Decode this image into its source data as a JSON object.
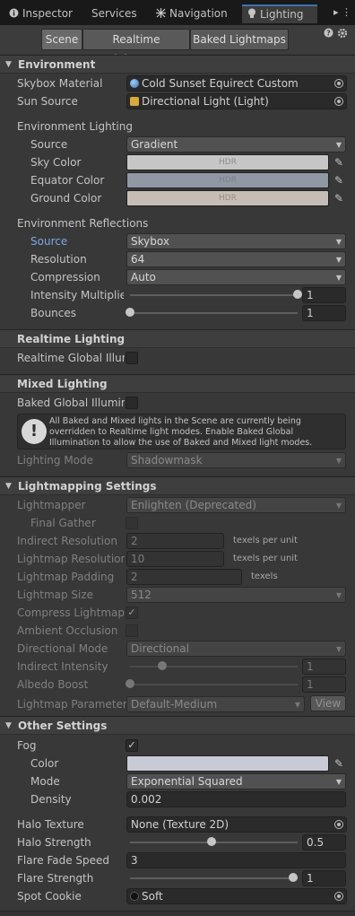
{
  "tabs": {
    "inspector": "Inspector",
    "services": "Services",
    "navigation": "Navigation",
    "lighting": "Lighting"
  },
  "subtabs": {
    "scene": "Scene",
    "realtime": "Realtime Lightmaps",
    "baked": "Baked Lightmaps"
  },
  "environment": {
    "header": "Environment",
    "skybox_label": "Skybox Material",
    "skybox_value": "Cold Sunset Equirect Custom",
    "sun_label": "Sun Source",
    "sun_value": "Directional Light (Light)",
    "lighting_heading": "Environment Lighting",
    "source_label": "Source",
    "source_value": "Gradient",
    "sky_label": "Sky Color",
    "equator_label": "Equator Color",
    "ground_label": "Ground Color",
    "hdr": "HDR",
    "reflections_heading": "Environment Reflections",
    "ref_source_label": "Source",
    "ref_source_value": "Skybox",
    "resolution_label": "Resolution",
    "resolution_value": "64",
    "compression_label": "Compression",
    "compression_value": "Auto",
    "intensity_label": "Intensity Multiplier",
    "intensity_value": "1",
    "intensity_level": 1.0,
    "bounces_label": "Bounces",
    "bounces_value": "1",
    "bounces_level": 0.0
  },
  "realtime": {
    "header": "Realtime Lighting",
    "gi_label": "Realtime Global Illumination"
  },
  "mixed": {
    "header": "Mixed Lighting",
    "baked_gi_label": "Baked Global Illumination",
    "help_text": "All Baked and Mixed lights in the Scene are currently being overridden to Realtime light modes. Enable Baked Global Illumination to allow the use of Baked and Mixed light modes.",
    "mode_label": "Lighting Mode",
    "mode_value": "Shadowmask"
  },
  "lightmapping": {
    "header": "Lightmapping Settings",
    "lightmapper_label": "Lightmapper",
    "lightmapper_value": "Enlighten (Deprecated)",
    "final_gather_label": "Final Gather",
    "indirect_res_label": "Indirect Resolution",
    "indirect_res_value": "2",
    "lightmap_res_label": "Lightmap Resolution",
    "lightmap_res_value": "10",
    "texels_per_unit": "texels per unit",
    "padding_label": "Lightmap Padding",
    "padding_value": "2",
    "texels": "texels",
    "size_label": "Lightmap Size",
    "size_value": "512",
    "compress_label": "Compress Lightmaps",
    "ao_label": "Ambient Occlusion",
    "dir_mode_label": "Directional Mode",
    "dir_mode_value": "Directional",
    "indirect_int_label": "Indirect Intensity",
    "indirect_int_value": "1",
    "indirect_int_level": 0.2,
    "albedo_label": "Albedo Boost",
    "albedo_value": "1",
    "albedo_level": 0.0,
    "params_label": "Lightmap Parameters",
    "params_value": "Default-Medium",
    "view_label": "View"
  },
  "other": {
    "header": "Other Settings",
    "fog_label": "Fog",
    "color_label": "Color",
    "mode_label": "Mode",
    "mode_value": "Exponential Squared",
    "density_label": "Density",
    "density_value": "0.002",
    "halo_tex_label": "Halo Texture",
    "halo_tex_value": "None (Texture 2D)",
    "halo_str_label": "Halo Strength",
    "halo_str_value": "0.5",
    "halo_str_level": 0.5,
    "flare_fade_label": "Flare Fade Speed",
    "flare_fade_value": "3",
    "flare_str_label": "Flare Strength",
    "flare_str_value": "1",
    "flare_str_level": 1.0,
    "cookie_label": "Spot Cookie",
    "cookie_value": "Soft"
  },
  "colors": {
    "sky": "#c6c6c6",
    "equator": "#8f98a3",
    "ground": "#c6beb6",
    "fog": "#c8cbd6",
    "accent": "#3a72b0"
  },
  "icons": [
    "info-icon",
    "services-icon",
    "navigation-icon",
    "lightbulb-icon",
    "help-icon",
    "settings-icon",
    "eyedropper-icon",
    "object-picker-icon",
    "checkmark-icon",
    "info-circle-icon"
  ]
}
